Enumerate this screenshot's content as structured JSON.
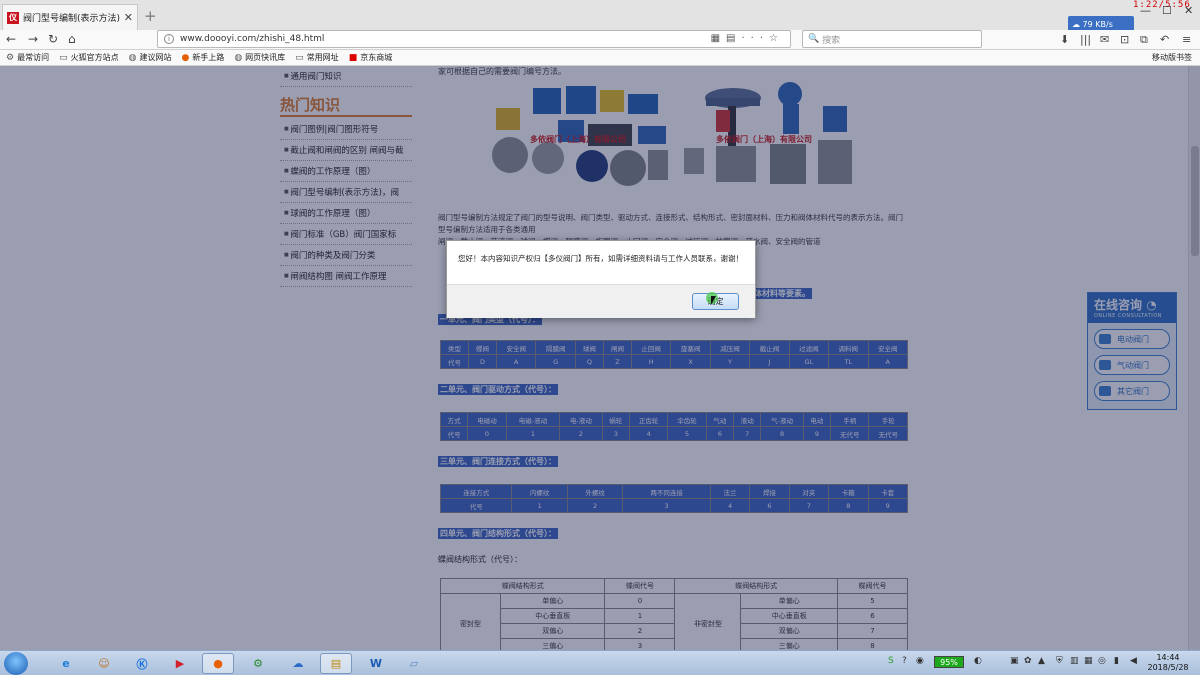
{
  "browser": {
    "tab_title": "阀门型号编制(表示方法)，阀门",
    "url": "www.doooyi.com/zhishi_48.html",
    "search_placeholder": "搜索",
    "net_speed": "79 KB/s",
    "red_clock": "1:22/5:56",
    "bookmarks": [
      "最常访问",
      "火狐官方站点",
      "建议网站",
      "新手上路",
      "网页快讯库",
      "常用网址",
      "京东商城"
    ],
    "mobile_bookmarks": "移动版书签"
  },
  "sidebar": {
    "top_item": "通用阀门知识",
    "heading": "热门知识",
    "items": [
      "阀门图例|阀门图形符号",
      "截止阀和闸阀的区别 闸阀与截",
      "蝶阀的工作原理（图）",
      "阀门型号编制(表示方法)，阀",
      "球阀的工作原理（图）",
      "阀门标准（GB）阀门国家标",
      "阀门的种类及阀门分类",
      "闸阀结构图 闸阀工作原理"
    ]
  },
  "content": {
    "intro": "家可根据自己的需要阀门编号方法。",
    "img_caption_left": "多依阀门（上海）有限公司",
    "img_caption_right": "多依阀门（上海）有限公司",
    "paragraph": "阀门型号编制方法规定了阀门的型号说明、阀门类型、驱动方式、连接形式、结构形式、密封面材料、压力和阀体材料代号的表示方法。阀门型号编制方法适用于各类通用 ",
    "paragraph2": "闸阀、截止阀、节流阀、球阀、蝶阀、隔膜阀、旋塞阀、止回阀、安全阀、减压阀、柱塞阀、疏水阀、安全阀的管道",
    "highlight_row": "料、阀体材料等要素。",
    "section1": "一单元、阀门类型（代号）：",
    "table1": {
      "names": [
        "类型",
        "蝶阀",
        "安全阀",
        "隔膜阀",
        "球阀",
        "闸阀",
        "止回阀",
        "旋塞阀",
        "减压阀",
        "截止阀",
        "过滤阀",
        "调料阀",
        "安全阀"
      ],
      "codes": [
        "代号",
        "D",
        "A",
        "G",
        "Q",
        "Z",
        "H",
        "X",
        "Y",
        "J",
        "GL",
        "TL",
        "A"
      ]
    },
    "section2": "二单元、阀门驱动方式（代号）：",
    "table2": {
      "names": [
        "方式",
        "电磁动",
        "电磁-液动",
        "电-液动",
        "蜗轮",
        "正齿轮",
        "伞齿轮",
        "气动",
        "液动",
        "气-液动",
        "电动",
        "手柄",
        "手轮"
      ],
      "codes": [
        "代号",
        "0",
        "1",
        "2",
        "3",
        "4",
        "5",
        "6",
        "7",
        "8",
        "9",
        "无代号",
        "无代号"
      ]
    },
    "section3": "三单元、阀门连接方式（代号）：",
    "table3": {
      "names": [
        "连接方式",
        "内螺纹",
        "外螺纹",
        "两不同连接",
        "法兰",
        "焊接",
        "对夹",
        "卡箍",
        "卡套"
      ],
      "codes": [
        "代号",
        "1",
        "2",
        "3",
        "4",
        "6",
        "7",
        "8",
        "9"
      ]
    },
    "section4": "四单元、阀门结构形式（代号）：",
    "sub_heading": "蝶阀结构形式（代号）：",
    "big_table": {
      "header": [
        "蝶阀结构形式",
        "蝶阀代号",
        "蝶阀结构形式",
        "蝶阀代号"
      ],
      "left_group": "密封型",
      "right_group": "非密封型",
      "rows": [
        [
          "单偏心",
          "0",
          "单偏心",
          "5"
        ],
        [
          "中心垂直板",
          "1",
          "中心垂直板",
          "6"
        ],
        [
          "双偏心",
          "2",
          "双偏心",
          "7"
        ],
        [
          "三偏心",
          "3",
          "三偏心",
          "8"
        ]
      ]
    }
  },
  "consult": {
    "title": "在线咨询",
    "subtitle": "ONLINE CONSULTATION",
    "buttons": [
      "电动阀门",
      "气动阀门",
      "其它阀门"
    ]
  },
  "dialog": {
    "message": "您好！本内容知识产权归【多仪阀门】所有，如需详细资料请与工作人员联系，谢谢！",
    "ok_label": "确定"
  },
  "taskbar": {
    "battery": "95%",
    "time": "14:44",
    "date": "2018/5/28"
  }
}
